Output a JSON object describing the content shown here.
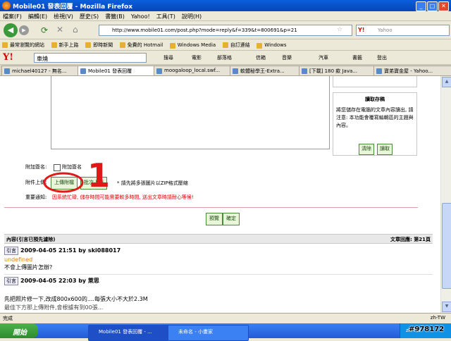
{
  "window": {
    "title": "Mobile01 發表回覆 - Mozilla Firefox",
    "min": "_",
    "max": "□",
    "close": "✕"
  },
  "menu": [
    "檔案(F)",
    "編輯(E)",
    "檢視(V)",
    "歷史(S)",
    "書籤(B)",
    "Yahoo!",
    "工具(T)",
    "說明(H)"
  ],
  "nav": {
    "url": "http://www.mobile01.com/post.php?mode=reply&f=339&t=800691&p=21",
    "search_placeholder": "Yahoo"
  },
  "bookmarks": [
    "最常瀏覽的網站",
    "新手上路",
    "即時新聞",
    "免費的 Hotmail",
    "Windows Media",
    "自訂連結",
    "Windows"
  ],
  "ytoolbar": {
    "logo": "Y!",
    "query": "車燒",
    "items": [
      "搜尋",
      "電影",
      "部落格",
      "信箱",
      "音樂",
      "汽車",
      "書籤",
      "登出"
    ]
  },
  "tabs": [
    "michael40127 - 無名...",
    "Mobile01 發表回覆",
    "moogaloop_local.swf...",
    "軟體秘學王-Extra...",
    "[下載] 180 款 Java...",
    "寶弟寶金屋 - Yahoo..."
  ],
  "draft": {
    "title": "讀取存稿",
    "desc": "將您儲存在電腦的文章內容讀出, 請注意: 本功能會覆寫編輯區的主題與內容。",
    "clear": "清除",
    "load": "讀取"
  },
  "form": {
    "sig_label": "附加簽名:",
    "sig_check": "附加簽名",
    "attach_label": "附件上傳:",
    "upload_btn": "上傳附檔",
    "batch_btn": "批次上傳",
    "note": "* 請先將多張圖片以ZIP格式壓縮",
    "notice_label": "重要通知:",
    "notice": "因系統忙碌, 儲存時間可能需要較多時間, 送出文章時請耐心等候!",
    "preview": "預覽",
    "submit": "確定"
  },
  "annotation": {
    "text": "1"
  },
  "posts_header": {
    "left": "內容(引言已預先濾除)",
    "right": "文章回應: 第21頁"
  },
  "posts": [
    {
      "quote": "引言",
      "meta": "2009-04-05 21:51 by ski088017",
      "sub": "undefined",
      "body": "不會上傳圖片怎辦?"
    },
    {
      "quote": "引言",
      "meta": "2009-04-05 22:03 by 萊思",
      "sub": "",
      "body": "先把照片修一下,改成800x600的....每張大小不大於2.3M"
    },
    {
      "quote": "",
      "meta": "",
      "sub": "",
      "body": "最佳下方那上傳附件,會根據有到00張..."
    }
  ],
  "status": {
    "text": "完成",
    "lang": "zh-TW"
  },
  "taskbar": {
    "start": "開始",
    "tasks": [
      "Mobile01 發表回覆 - ...",
      "未命名 - 小畫家"
    ],
    "clock": "zh-TW"
  },
  "watermark": "#978172"
}
